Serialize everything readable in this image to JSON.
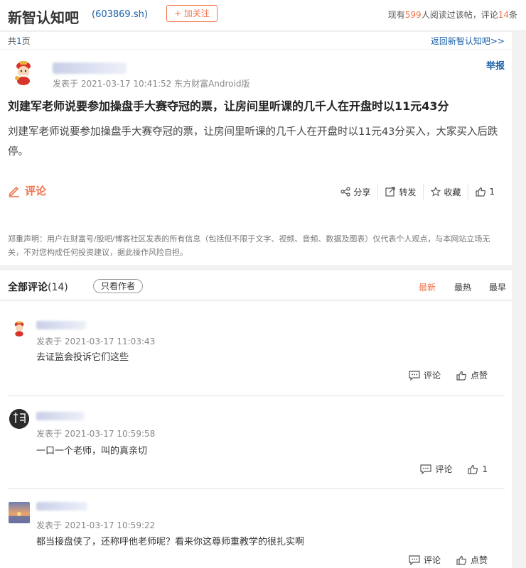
{
  "header": {
    "title": "新智认知吧",
    "code": "(603869.sh)",
    "follow_label": "+ 加关注",
    "stats": {
      "prefix": "现有",
      "readers": "599",
      "middle": "人阅读过该帖，评论",
      "comments": "14",
      "suffix": "条"
    }
  },
  "pager": {
    "prefix": "共",
    "total": "1",
    "suffix": "页",
    "back": "返回新智认知吧>>"
  },
  "post": {
    "meta": "发表于 2021-03-17 10:41:52 东方财富Android版",
    "report": "举报",
    "title": "刘建军老师说要参加操盘手大赛夺冠的票，让房间里听课的几千人在开盘时以11元43分",
    "body": "刘建军老师说要参加操盘手大赛夺冠的票，让房间里听课的几千人在开盘时以11元43分买入，大家买入后跌停。",
    "comment_label": "评论",
    "actions": {
      "share": "分享",
      "forward": "转发",
      "favorite": "收藏",
      "like_count": "1"
    },
    "disclaimer": "郑重声明：用户在财富号/股吧/博客社区发表的所有信息（包括但不限于文字、视频、音频、数据及图表）仅代表个人观点，与本网站立场无关，不对您构成任何投资建议，据此操作风险自担。"
  },
  "comments_header": {
    "title": "全部评论",
    "count": "(14)",
    "author_only": "只看作者",
    "sort": [
      "最新",
      "最热",
      "最早"
    ]
  },
  "comments": [
    {
      "meta": "发表于 2021-03-17 11:03:43",
      "text": "去证监会投诉它们这些",
      "reply": "评论",
      "like": "点赞"
    },
    {
      "meta": "发表于 2021-03-17 10:59:58",
      "text": "一口一个老师，叫的真亲切",
      "reply": "评论",
      "like": "1"
    },
    {
      "meta": "发表于 2021-03-17 10:59:22",
      "text": "都当接盘侠了，还称呼他老师呢？看来你这尊师重教学的很扎实啊",
      "reply": "评论",
      "like": "点赞"
    }
  ],
  "colors": {
    "accent": "#f2734a",
    "link": "#1a5fa8"
  }
}
